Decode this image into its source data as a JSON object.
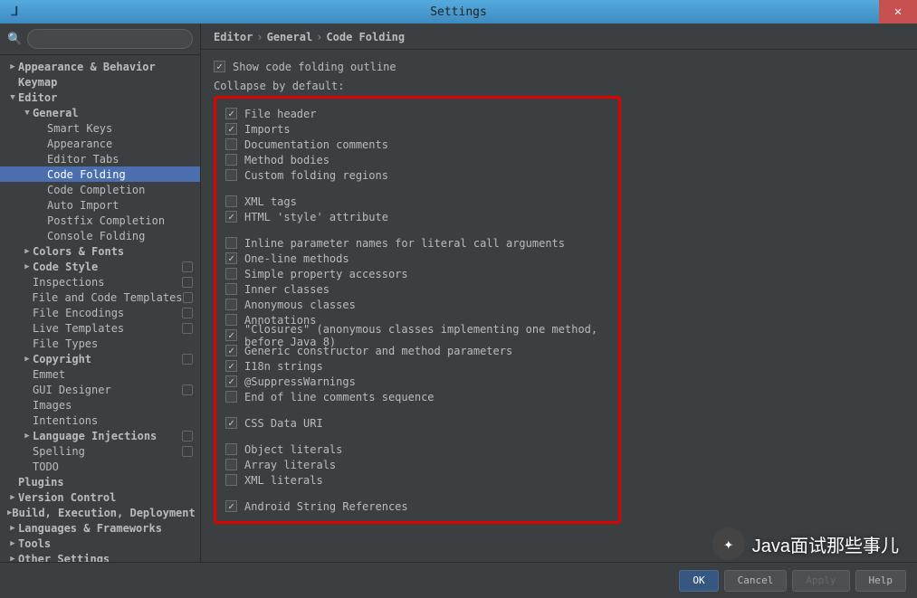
{
  "window": {
    "title": "Settings"
  },
  "search": {
    "placeholder": ""
  },
  "breadcrumb": {
    "parts": [
      "Editor",
      "General",
      "Code Folding"
    ]
  },
  "tree": [
    {
      "label": "Appearance & Behavior",
      "indent": 0,
      "arrow": "collapsed",
      "bold": true
    },
    {
      "label": "Keymap",
      "indent": 0,
      "arrow": "",
      "bold": true
    },
    {
      "label": "Editor",
      "indent": 0,
      "arrow": "expanded",
      "bold": true
    },
    {
      "label": "General",
      "indent": 1,
      "arrow": "expanded",
      "bold": true
    },
    {
      "label": "Smart Keys",
      "indent": 2,
      "arrow": ""
    },
    {
      "label": "Appearance",
      "indent": 2,
      "arrow": ""
    },
    {
      "label": "Editor Tabs",
      "indent": 2,
      "arrow": ""
    },
    {
      "label": "Code Folding",
      "indent": 2,
      "arrow": "",
      "selected": true
    },
    {
      "label": "Code Completion",
      "indent": 2,
      "arrow": ""
    },
    {
      "label": "Auto Import",
      "indent": 2,
      "arrow": ""
    },
    {
      "label": "Postfix Completion",
      "indent": 2,
      "arrow": ""
    },
    {
      "label": "Console Folding",
      "indent": 2,
      "arrow": ""
    },
    {
      "label": "Colors & Fonts",
      "indent": 1,
      "arrow": "collapsed",
      "bold": true
    },
    {
      "label": "Code Style",
      "indent": 1,
      "arrow": "collapsed",
      "bold": true,
      "badge": true
    },
    {
      "label": "Inspections",
      "indent": 1,
      "arrow": "",
      "badge": true
    },
    {
      "label": "File and Code Templates",
      "indent": 1,
      "arrow": "",
      "badge": true
    },
    {
      "label": "File Encodings",
      "indent": 1,
      "arrow": "",
      "badge": true
    },
    {
      "label": "Live Templates",
      "indent": 1,
      "arrow": "",
      "badge": true
    },
    {
      "label": "File Types",
      "indent": 1,
      "arrow": ""
    },
    {
      "label": "Copyright",
      "indent": 1,
      "arrow": "collapsed",
      "bold": true,
      "badge": true
    },
    {
      "label": "Emmet",
      "indent": 1,
      "arrow": ""
    },
    {
      "label": "GUI Designer",
      "indent": 1,
      "arrow": "",
      "badge": true
    },
    {
      "label": "Images",
      "indent": 1,
      "arrow": ""
    },
    {
      "label": "Intentions",
      "indent": 1,
      "arrow": ""
    },
    {
      "label": "Language Injections",
      "indent": 1,
      "arrow": "collapsed",
      "bold": true,
      "badge": true
    },
    {
      "label": "Spelling",
      "indent": 1,
      "arrow": "",
      "badge": true
    },
    {
      "label": "TODO",
      "indent": 1,
      "arrow": ""
    },
    {
      "label": "Plugins",
      "indent": 0,
      "arrow": "",
      "bold": true
    },
    {
      "label": "Version Control",
      "indent": 0,
      "arrow": "collapsed",
      "bold": true
    },
    {
      "label": "Build, Execution, Deployment",
      "indent": 0,
      "arrow": "collapsed",
      "bold": true
    },
    {
      "label": "Languages & Frameworks",
      "indent": 0,
      "arrow": "collapsed",
      "bold": true
    },
    {
      "label": "Tools",
      "indent": 0,
      "arrow": "collapsed",
      "bold": true
    },
    {
      "label": "Other Settings",
      "indent": 0,
      "arrow": "collapsed",
      "bold": true
    }
  ],
  "topCheckbox": {
    "label": "Show code folding outline",
    "checked": true
  },
  "sectionLabel": "Collapse by default:",
  "groups": [
    [
      {
        "label": "File header",
        "checked": true
      },
      {
        "label": "Imports",
        "checked": true
      },
      {
        "label": "Documentation comments",
        "checked": false
      },
      {
        "label": "Method bodies",
        "checked": false
      },
      {
        "label": "Custom folding regions",
        "checked": false
      }
    ],
    [
      {
        "label": "XML tags",
        "checked": false
      },
      {
        "label": "HTML 'style' attribute",
        "checked": true
      }
    ],
    [
      {
        "label": "Inline parameter names for literal call arguments",
        "checked": false
      },
      {
        "label": "One-line methods",
        "checked": true
      },
      {
        "label": "Simple property accessors",
        "checked": false
      },
      {
        "label": "Inner classes",
        "checked": false
      },
      {
        "label": "Anonymous classes",
        "checked": false
      },
      {
        "label": "Annotations",
        "checked": false
      },
      {
        "label": "\"Closures\" (anonymous classes implementing one method, before Java 8)",
        "checked": true
      },
      {
        "label": "Generic constructor and method parameters",
        "checked": true
      },
      {
        "label": "I18n strings",
        "checked": true
      },
      {
        "label": "@SuppressWarnings",
        "checked": true
      },
      {
        "label": "End of line comments sequence",
        "checked": false
      }
    ],
    [
      {
        "label": "CSS Data URI",
        "checked": true
      }
    ],
    [
      {
        "label": "Object literals",
        "checked": false
      },
      {
        "label": "Array literals",
        "checked": false
      },
      {
        "label": "XML literals",
        "checked": false
      }
    ],
    [
      {
        "label": "Android String References",
        "checked": true
      }
    ]
  ],
  "buttons": {
    "ok": "OK",
    "cancel": "Cancel",
    "apply": "Apply",
    "help": "Help"
  },
  "watermark": "Java面试那些事儿"
}
